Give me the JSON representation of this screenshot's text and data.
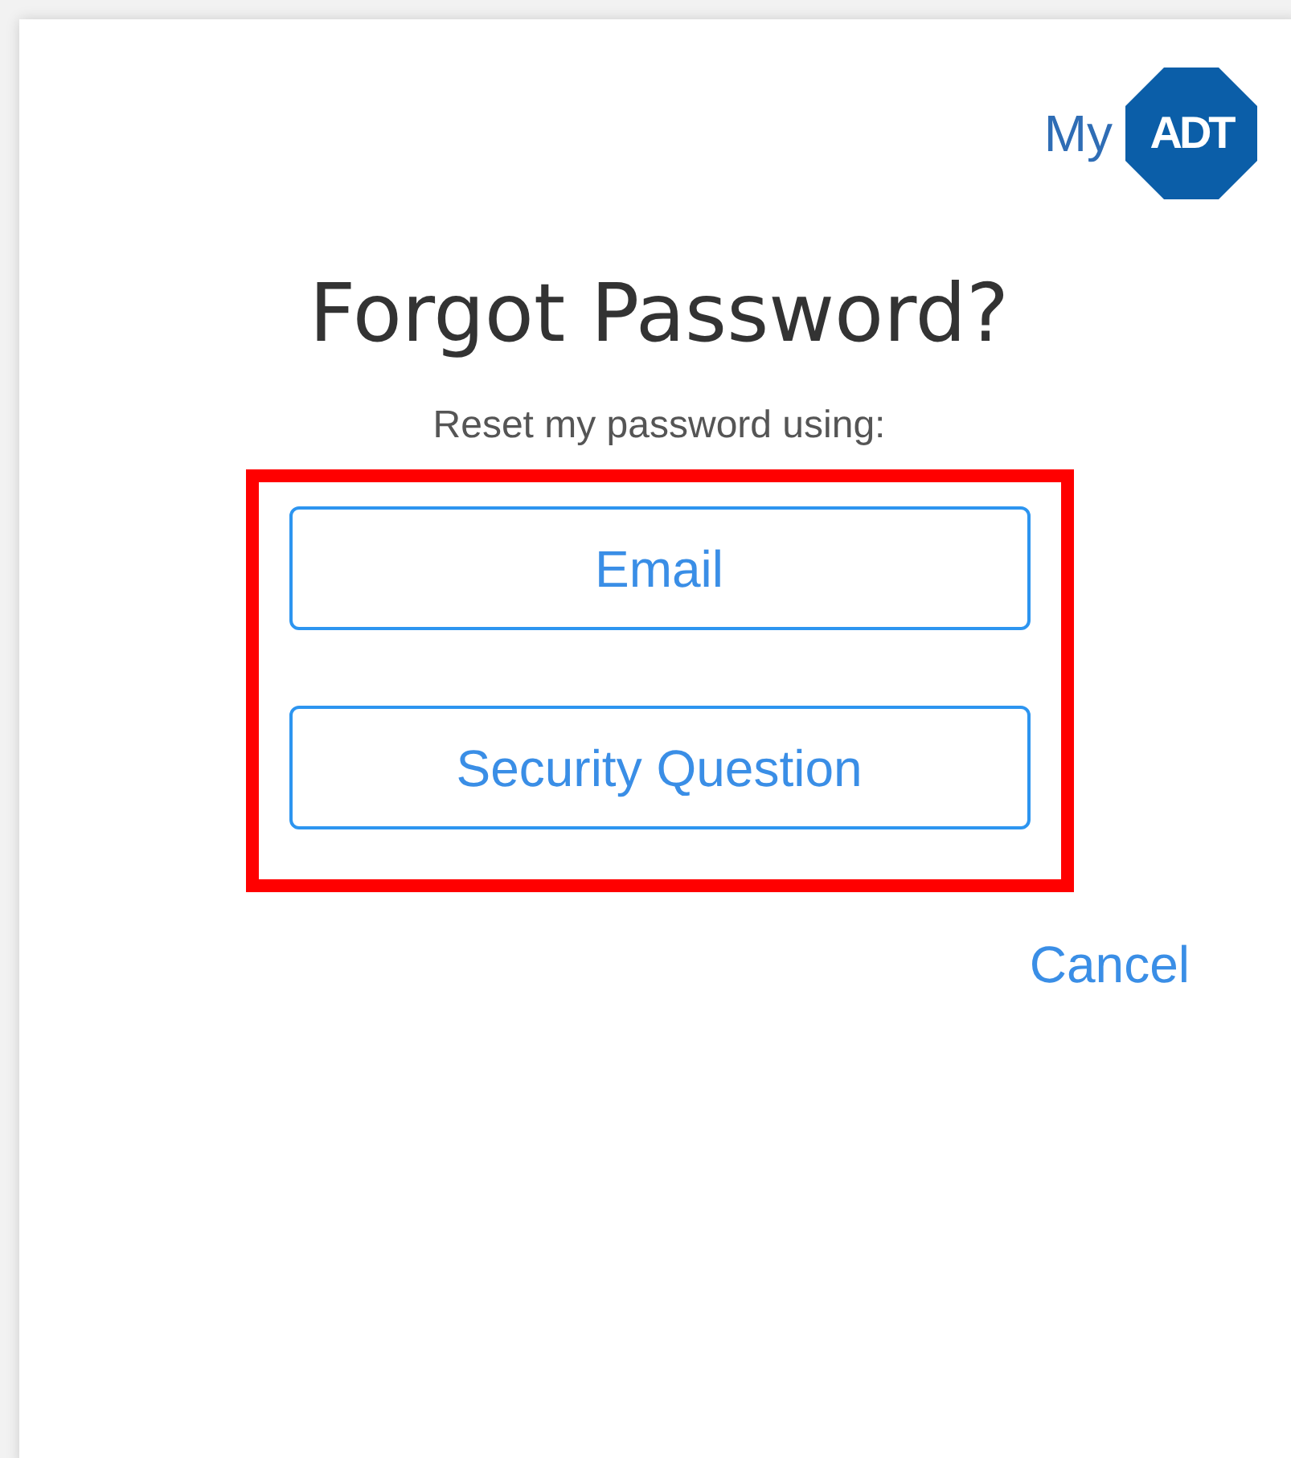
{
  "logo": {
    "prefix": "My",
    "mark": "ADT"
  },
  "title": "Forgot Password?",
  "subtitle": "Reset my password using:",
  "options": [
    {
      "label": "Email"
    },
    {
      "label": "Security Question"
    }
  ],
  "cancel": "Cancel"
}
